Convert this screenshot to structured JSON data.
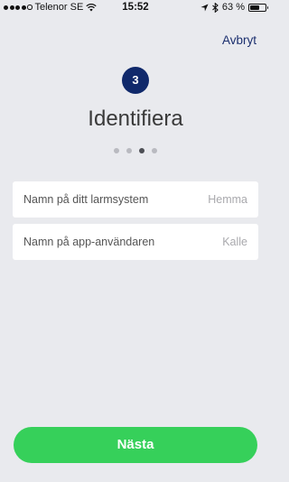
{
  "status_bar": {
    "carrier": "Telenor SE",
    "time": "15:52",
    "battery": "63 %",
    "battery_level": 0.63,
    "signal_bars_filled": 4,
    "signal_bars_total": 5,
    "icons": [
      "signal-icon",
      "wifi-icon",
      "location-icon",
      "bluetooth-icon",
      "battery-icon"
    ]
  },
  "header": {
    "cancel_label": "Avbryt"
  },
  "step": {
    "number": "3",
    "title": "Identifiera",
    "current_page": 3,
    "total_pages": 4
  },
  "form": {
    "fields": [
      {
        "label": "Namn på ditt larmsystem",
        "placeholder": "Hemma",
        "value": ""
      },
      {
        "label": "Namn på app-användaren",
        "placeholder": "Kalle",
        "value": ""
      }
    ]
  },
  "footer": {
    "next_label": "Nästa"
  },
  "colors": {
    "background": "#e9eaee",
    "accent_navy": "#10296b",
    "link": "#1b2f6e",
    "primary_button": "#36d05a"
  }
}
